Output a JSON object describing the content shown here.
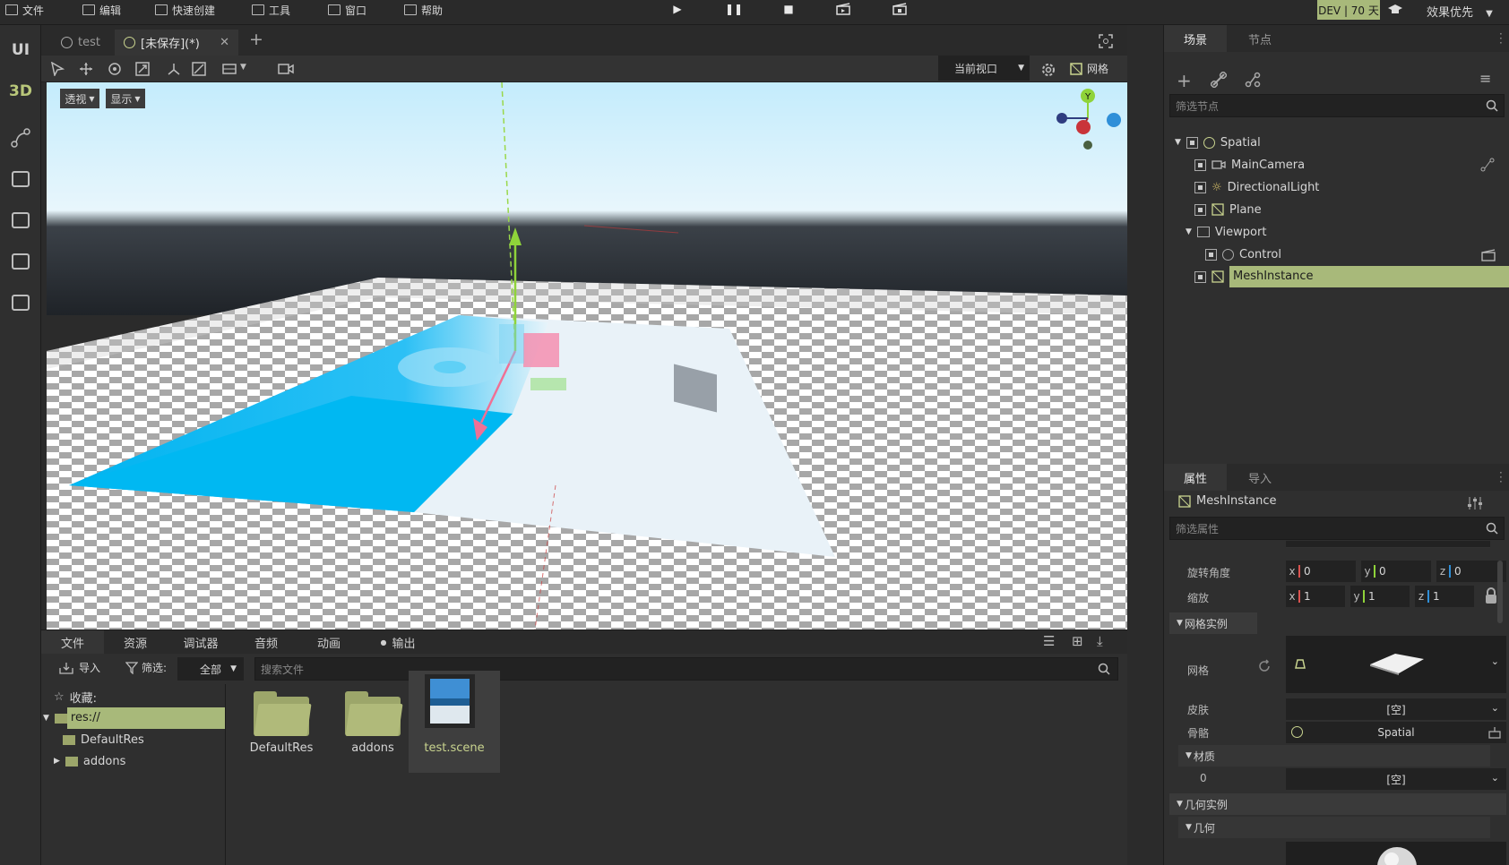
{
  "menu": {
    "file": "文件",
    "edit": "编辑",
    "quick_create": "快速创建",
    "tools": "工具",
    "window": "窗口",
    "help": "帮助",
    "dev_badge": "DEV | 70 天",
    "quality": "效果优先"
  },
  "rail": {
    "ui": "UI",
    "three_d": "3D"
  },
  "scene_tabs": [
    {
      "label": "test"
    },
    {
      "label": "[未保存](*)"
    }
  ],
  "viewport": {
    "current_view": "当前视口",
    "grid_label": "网格",
    "perspective": "透视",
    "display": "显示",
    "gizmo_y": "Y"
  },
  "scene_panel": {
    "tabs": [
      "场景",
      "节点"
    ],
    "filter_placeholder": "筛选节点",
    "tree": [
      {
        "name": "Spatial",
        "depth": 0
      },
      {
        "name": "MainCamera",
        "depth": 1
      },
      {
        "name": "DirectionalLight",
        "depth": 1
      },
      {
        "name": "Plane",
        "depth": 1
      },
      {
        "name": "Viewport",
        "depth": 1
      },
      {
        "name": "Control",
        "depth": 2
      },
      {
        "name": "MeshInstance",
        "depth": 1,
        "selected": true
      }
    ]
  },
  "inspector": {
    "tabs": [
      "属性",
      "导入"
    ],
    "node_name": "MeshInstance",
    "filter_placeholder": "筛选属性",
    "rotation_label": "旋转角度",
    "rotation": {
      "x": "0",
      "y": "0",
      "z": "0"
    },
    "scale_label": "缩放",
    "scale": {
      "x": "1",
      "y": "1",
      "z": "1"
    },
    "mesh_instance_section": "网格实例",
    "mesh_label": "网格",
    "skin_label": "皮肤",
    "skin_value": "[空]",
    "skeleton_label": "骨骼",
    "skeleton_value": "Spatial",
    "material_section": "材质",
    "material_index": "0",
    "material_value": "[空]",
    "geometry_instance_section": "几何实例",
    "geometry_section": "几何"
  },
  "file_panel": {
    "tabs": [
      "文件",
      "资源",
      "调试器",
      "音频",
      "动画",
      "输出"
    ],
    "import_label": "导入",
    "filter_label": "筛选:",
    "filter_value": "全部",
    "search_placeholder": "搜索文件",
    "favorites": "收藏:",
    "tree": [
      "res://",
      "DefaultRes",
      "addons"
    ],
    "files": [
      {
        "name": "DefaultRes",
        "type": "folder"
      },
      {
        "name": "addons",
        "type": "folder"
      },
      {
        "name": "test.scene",
        "type": "scene"
      }
    ]
  },
  "colors": {
    "accent_green": "#a8b97a",
    "panel_bg": "#2f2f2f",
    "sky_top": "#c4ecfc",
    "axis_x": "#d9534f",
    "axis_y": "#8fd33a",
    "axis_z": "#2f8fd8"
  }
}
